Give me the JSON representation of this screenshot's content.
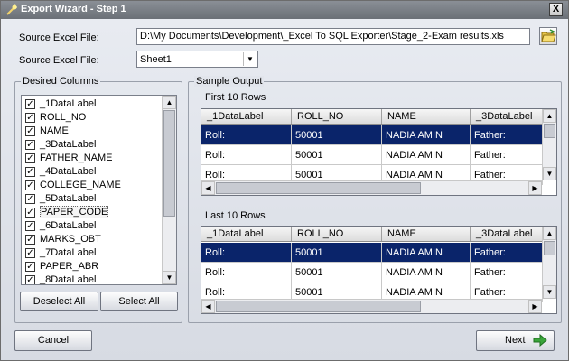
{
  "window": {
    "title": "Export Wizard - Step 1",
    "close_glyph": "X"
  },
  "source_file": {
    "label": "Source Excel File:",
    "value": "D:\\My Documents\\Development\\_Excel To SQL Exporter\\Stage_2-Exam results.xls"
  },
  "sheet": {
    "label": "Source Excel File:",
    "value": "Sheet1"
  },
  "desired_columns": {
    "legend": "Desired Columns",
    "items": [
      {
        "label": "_1DataLabel",
        "checked": true
      },
      {
        "label": "ROLL_NO",
        "checked": true
      },
      {
        "label": "NAME",
        "checked": true
      },
      {
        "label": "_3DataLabel",
        "checked": true
      },
      {
        "label": "FATHER_NAME",
        "checked": true
      },
      {
        "label": "_4DataLabel",
        "checked": true
      },
      {
        "label": "COLLEGE_NAME",
        "checked": true
      },
      {
        "label": "_5DataLabel",
        "checked": true
      },
      {
        "label": "PAPER_CODE",
        "checked": true
      },
      {
        "label": "_6DataLabel",
        "checked": true
      },
      {
        "label": "MARKS_OBT",
        "checked": true
      },
      {
        "label": "_7DataLabel",
        "checked": true
      },
      {
        "label": "PAPER_ABR",
        "checked": true
      },
      {
        "label": "_8DataLabel",
        "checked": true
      }
    ],
    "deselect_all": "Deselect All",
    "select_all": "Select All"
  },
  "sample_output": {
    "legend": "Sample Output",
    "first": {
      "label": "First 10 Rows",
      "columns": [
        "_1DataLabel",
        "ROLL_NO",
        "NAME",
        "_3DataLabel"
      ],
      "rows": [
        [
          "Roll:",
          "50001",
          "NADIA AMIN",
          "Father:"
        ],
        [
          "Roll:",
          "50001",
          "NADIA AMIN",
          "Father:"
        ],
        [
          "Roll:",
          "50001",
          "NADIA AMIN",
          "Father:"
        ]
      ]
    },
    "last": {
      "label": "Last 10 Rows",
      "columns": [
        "_1DataLabel",
        "ROLL_NO",
        "NAME",
        "_3DataLabel"
      ],
      "rows": [
        [
          "Roll:",
          "50001",
          "NADIA AMIN",
          "Father:"
        ],
        [
          "Roll:",
          "50001",
          "NADIA AMIN",
          "Father:"
        ],
        [
          "Roll:",
          "50001",
          "NADIA AMIN",
          "Father:"
        ]
      ]
    }
  },
  "footer": {
    "cancel": "Cancel",
    "next": "Next"
  },
  "colors": {
    "selection": "#0a246a",
    "next_arrow": "#3aa53a"
  }
}
